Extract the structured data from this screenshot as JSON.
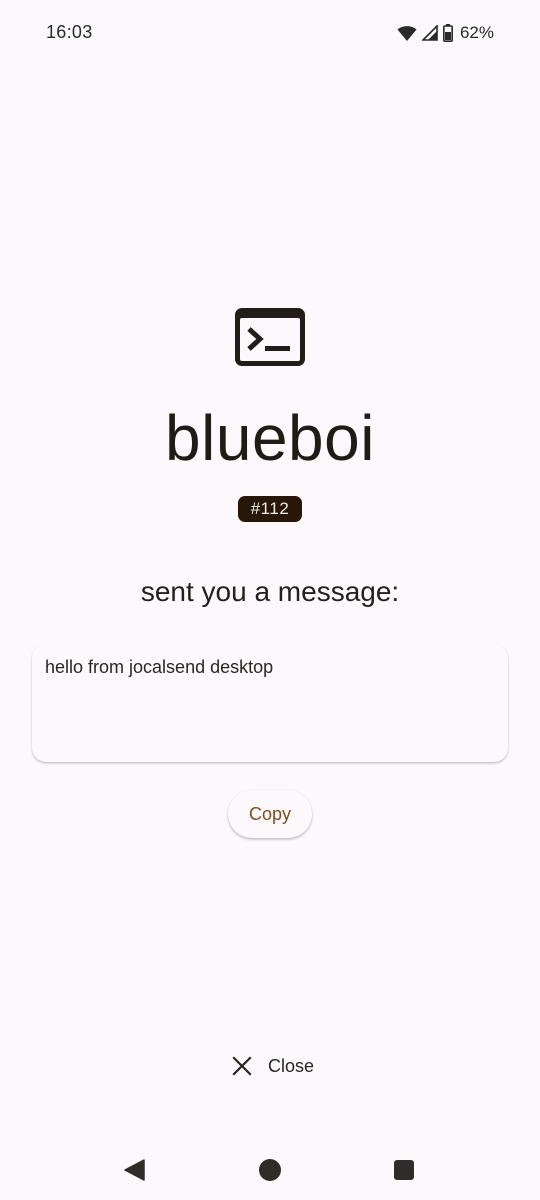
{
  "status_bar": {
    "time": "16:03",
    "battery_percent": "62%",
    "icons": [
      "wifi-icon",
      "cell-signal-icon",
      "battery-icon"
    ]
  },
  "sender": {
    "icon": "terminal-icon",
    "name": "blueboi",
    "tag": "#112"
  },
  "subtitle": "sent you a message:",
  "message": {
    "text": "hello from jocalsend desktop"
  },
  "actions": {
    "copy_label": "Copy",
    "close_label": "Close"
  },
  "nav": {
    "items": [
      "back-icon",
      "home-icon",
      "recents-icon"
    ]
  },
  "colors": {
    "background": "#fdf8fb",
    "tag_background": "#261708",
    "accent_text": "#7c4f20"
  }
}
